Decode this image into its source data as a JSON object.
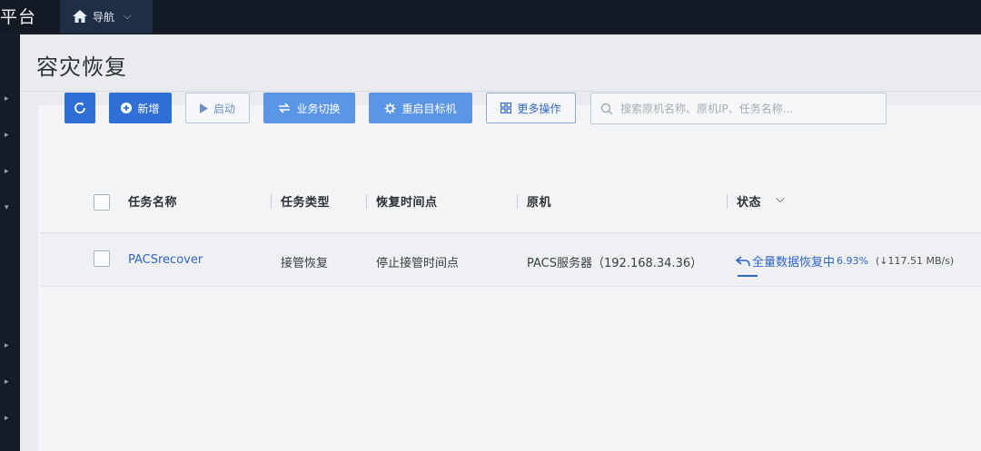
{
  "topbar": {
    "platform_text": "平台",
    "nav_label": "导航"
  },
  "page": {
    "title": "容灾恢复"
  },
  "toolbar": {
    "add_label": "新增",
    "start_label": "启动",
    "switch_label": "业务切换",
    "restart_label": "重启目标机",
    "more_label": "更多操作",
    "search_placeholder": "搜索原机名称、原机IP、任务名称..."
  },
  "table": {
    "columns": [
      "任务名称",
      "任务类型",
      "恢复时间点",
      "原机",
      "状态"
    ],
    "rows": [
      {
        "name": "PACSrecover",
        "type": "接管恢复",
        "time_point": "停止接管时间点",
        "source": "PACS服务器（192.168.34.36）",
        "status": "全量数据恢复中",
        "percent": "6.93%",
        "speed": "(↓117.51 MB/s)"
      }
    ]
  },
  "colors": {
    "primary": "#2f6fd6",
    "link": "#2f66c4",
    "topbar": "#141a23"
  }
}
